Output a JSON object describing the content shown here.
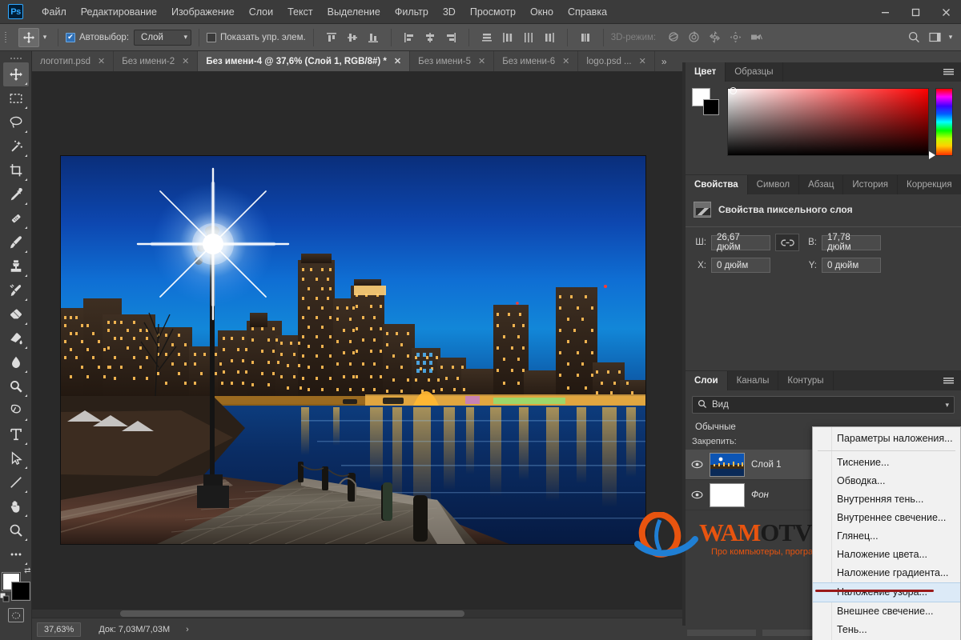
{
  "app": {
    "name": "Ps",
    "title_bar_logo": "Ps"
  },
  "menubar": {
    "items": [
      {
        "label": "Файл"
      },
      {
        "label": "Редактирование"
      },
      {
        "label": "Изображение"
      },
      {
        "label": "Слои"
      },
      {
        "label": "Текст"
      },
      {
        "label": "Выделение"
      },
      {
        "label": "Фильтр"
      },
      {
        "label": "3D"
      },
      {
        "label": "Просмотр"
      },
      {
        "label": "Окно"
      },
      {
        "label": "Справка"
      }
    ]
  },
  "window_controls": {
    "minimize": "minimize-icon",
    "maximize": "maximize-icon",
    "close": "close-icon"
  },
  "options_bar": {
    "tool": "move-tool",
    "autoselect_label": "Автовыбор:",
    "autoselect_checked": true,
    "autoselect_value": "Слой",
    "show_controls_label": "Показать упр. элем.",
    "show_controls_checked": false,
    "threed_mode_label": "3D-режим:",
    "align_icons": [
      "align-top-edges-icon",
      "align-vertical-centers-icon",
      "align-bottom-edges-icon",
      "align-left-edges-icon",
      "align-horizontal-centers-icon",
      "align-right-edges-icon"
    ],
    "distribute_icons": [
      "distribute-top-icon",
      "distribute-vertical-center-icon",
      "distribute-bottom-icon",
      "distribute-left-icon",
      "distribute-horizontal-center-icon",
      "distribute-right-icon"
    ],
    "threed_icons": [
      "orbit-3d-icon",
      "roll-3d-icon",
      "pan-3d-icon",
      "slide-3d-icon",
      "camera-3d-icon"
    ],
    "right_icons": [
      "search-icon",
      "workspace-icon",
      "chevron-down-icon"
    ]
  },
  "document_tabs": {
    "more": "»",
    "items": [
      {
        "label": "логотип.psd",
        "active": false,
        "close": "✕"
      },
      {
        "label": "Без имени-2",
        "active": false,
        "close": "✕"
      },
      {
        "label": "Без имени-4 @ 37,6% (Слой 1, RGB/8#) *",
        "active": true,
        "close": "✕"
      },
      {
        "label": "Без имени-5",
        "active": false,
        "close": "✕"
      },
      {
        "label": "Без имени-6",
        "active": false,
        "close": "✕"
      },
      {
        "label": "logo.psd ...",
        "active": false,
        "close": "✕"
      }
    ]
  },
  "toolbar": {
    "tools": [
      {
        "name": "move-tool",
        "active": true
      },
      {
        "name": "rectangular-marquee-tool",
        "active": false
      },
      {
        "name": "lasso-tool",
        "active": false
      },
      {
        "name": "quick-selection-tool",
        "active": false
      },
      {
        "name": "crop-tool",
        "active": false
      },
      {
        "name": "eyedropper-tool",
        "active": false
      },
      {
        "name": "healing-brush-tool",
        "active": false
      },
      {
        "name": "brush-tool",
        "active": false
      },
      {
        "name": "clone-stamp-tool",
        "active": false
      },
      {
        "name": "history-brush-tool",
        "active": false
      },
      {
        "name": "eraser-tool",
        "active": false
      },
      {
        "name": "gradient-tool",
        "active": false
      },
      {
        "name": "blur-tool",
        "active": false
      },
      {
        "name": "dodge-tool",
        "active": false
      },
      {
        "name": "pen-tool",
        "active": false
      },
      {
        "name": "type-tool",
        "active": false
      },
      {
        "name": "path-selection-tool",
        "active": false
      },
      {
        "name": "line-shape-tool",
        "active": false
      },
      {
        "name": "hand-tool",
        "active": false
      },
      {
        "name": "zoom-tool",
        "active": false
      },
      {
        "name": "edit-toolbar-tool",
        "active": false
      }
    ],
    "foreground_color": "#ffffff",
    "background_color": "#000000",
    "quick_mask": "quick-mask-icon"
  },
  "canvas": {
    "image_title": "Boston Harbor night skyline",
    "zoom": "37,63%"
  },
  "status_bar": {
    "zoom": "37,63%",
    "doc_info": "Док: 7,03М/7,03М",
    "expand_arrow": "›"
  },
  "color_panel": {
    "tabs": [
      {
        "label": "Цвет",
        "active": true
      },
      {
        "label": "Образцы",
        "active": false
      }
    ],
    "menu_icon": "panel-menu-icon",
    "foreground": "#ffffff",
    "background": "#000000"
  },
  "properties_panel": {
    "tabs": [
      {
        "label": "Свойства",
        "active": true
      },
      {
        "label": "Символ",
        "active": false
      },
      {
        "label": "Абзац",
        "active": false
      },
      {
        "label": "История",
        "active": false
      },
      {
        "label": "Коррекция",
        "active": false
      }
    ],
    "menu_icon": "panel-menu-icon",
    "heading": "Свойства пиксельного слоя",
    "fields": [
      {
        "label": "Ш:",
        "value": "26,67 дюйм"
      },
      {
        "label": "В:",
        "value": "17,78 дюйм"
      },
      {
        "label": "X:",
        "value": "0 дюйм"
      },
      {
        "label": "Y:",
        "value": "0 дюйм"
      }
    ],
    "link_icon": "link-chain-icon"
  },
  "layers_panel": {
    "tabs": [
      {
        "label": "Слои",
        "active": true
      },
      {
        "label": "Каналы",
        "active": false
      },
      {
        "label": "Контуры",
        "active": false
      }
    ],
    "filter_value": "Вид",
    "filter_icon": "search-icon",
    "filter_caret": "chevron-down-icon",
    "blend_mode": "Обычные",
    "lock_label": "Закрепить:",
    "layers": [
      {
        "name": "Слой 1",
        "visible": true,
        "selected": true,
        "thumb": "photo",
        "italic": false
      },
      {
        "name": "Фон",
        "visible": true,
        "selected": false,
        "thumb": "white",
        "italic": true
      }
    ],
    "footer_icon": "link-layers-icon"
  },
  "watermark": {
    "part1": "WAM",
    "part2": "OTVET.RU",
    "subtitle": "Про компьютеры, программы и сервисы",
    "logo": "wamotvet-logo-icon"
  },
  "context_menu": {
    "items": [
      {
        "label": "Параметры наложения...",
        "highlighted": false,
        "separator_after": true
      },
      {
        "label": "Тиснение...",
        "highlighted": false,
        "separator_after": false
      },
      {
        "label": "Обводка...",
        "highlighted": false,
        "separator_after": false
      },
      {
        "label": "Внутренняя тень...",
        "highlighted": false,
        "separator_after": false
      },
      {
        "label": "Внутреннее свечение...",
        "highlighted": false,
        "separator_after": false
      },
      {
        "label": "Глянец...",
        "highlighted": false,
        "separator_after": false
      },
      {
        "label": "Наложение цвета...",
        "highlighted": false,
        "separator_after": false
      },
      {
        "label": "Наложение градиента...",
        "highlighted": false,
        "separator_after": false
      },
      {
        "label": "Наложение узора...",
        "highlighted": true,
        "separator_after": false
      },
      {
        "label": "Внешнее свечение...",
        "highlighted": false,
        "separator_after": false
      },
      {
        "label": "Тень...",
        "highlighted": false,
        "separator_after": false
      }
    ]
  },
  "colors": {
    "chrome": "#3b3b3b",
    "options_bar": "#535353",
    "canvas_bg": "#292929",
    "accent_blue": "#31a8ff",
    "menu_highlight": "#dceaf7",
    "underline_red": "#9a1a1a",
    "watermark_orange": "#e8540f"
  }
}
